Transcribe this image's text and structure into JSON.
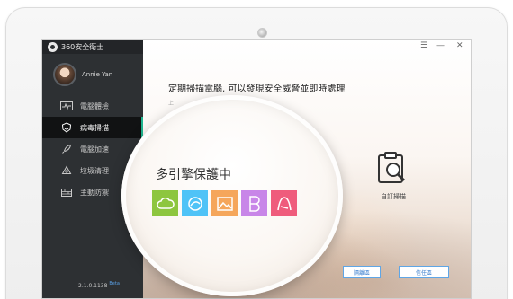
{
  "app": {
    "title": "360安全衛士"
  },
  "user": {
    "name": "Annie Yan"
  },
  "nav": [
    {
      "label": "電腦體檢",
      "icon": "pulse-icon"
    },
    {
      "label": "病毒掃描",
      "icon": "virus-shield-icon"
    },
    {
      "label": "電腦加速",
      "icon": "rocket-icon"
    },
    {
      "label": "垃圾清理",
      "icon": "recycle-icon"
    },
    {
      "label": "主動防禦",
      "icon": "firewall-icon"
    }
  ],
  "active_nav": "病毒掃描",
  "version": {
    "number": "2.1.0.1138",
    "tag": "Beta"
  },
  "main": {
    "headline": "定期掃描電腦, 可以發現安全威脅並即時處理",
    "subtext": "上",
    "custom_scan_label": "自訂掃描",
    "buttons": {
      "quarantine": "隔離區",
      "trust": "信任區"
    }
  },
  "window_controls": {
    "menu": "☰",
    "minimize": "—",
    "close": "✕"
  },
  "magnifier": {
    "title": "多引擎保護中",
    "engines": [
      {
        "name": "cloud-engine-icon",
        "color": "#8dc63f"
      },
      {
        "name": "swirl-engine-icon",
        "color": "#4fc3f7"
      },
      {
        "name": "image-engine-icon",
        "color": "#f5a65b"
      },
      {
        "name": "b-engine-icon",
        "color": "#c886e8"
      },
      {
        "name": "avira-engine-icon",
        "color": "#ef5c7c"
      }
    ]
  },
  "colors": {
    "sidebar": "#2d3033",
    "accent": "#1fb58f",
    "link": "#3a7fcf"
  }
}
